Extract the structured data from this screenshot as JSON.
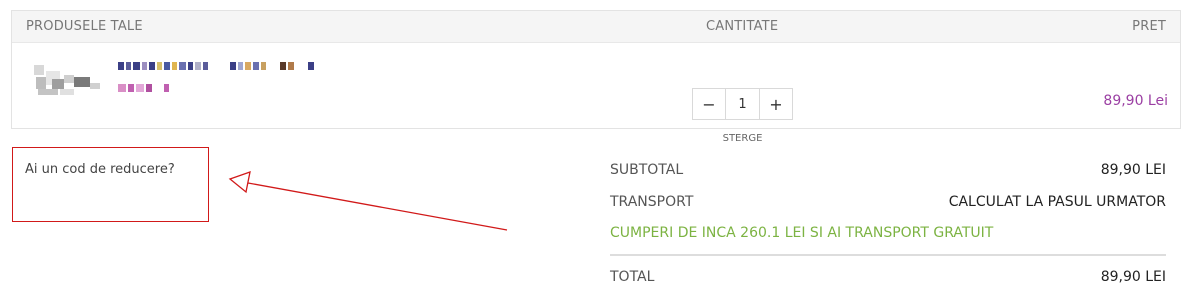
{
  "cart": {
    "headers": {
      "product": "PRODUSELE TALE",
      "quantity": "CANTITATE",
      "price": "PRET"
    },
    "items": [
      {
        "quantity": "1",
        "remove_label": "STERGE",
        "price": "89,90 Lei",
        "price_color": "#9b3fa3",
        "minus_icon": "minus-icon",
        "plus_icon": "plus-icon"
      }
    ]
  },
  "coupon": {
    "link_text": "Ai un cod de reducere?",
    "highlight_color": "#d11919"
  },
  "totals": {
    "subtotal_label": "SUBTOTAL",
    "subtotal_value": "89,90 LEI",
    "shipping_label": "TRANSPORT",
    "shipping_value": "CALCULAT LA PASUL URMATOR",
    "free_shipping_note": "CUMPERI DE INCA 260.1 LEI SI AI TRANSPORT GRATUIT",
    "free_shipping_color": "#7cb342",
    "total_label": "TOTAL",
    "total_value": "89,90 LEI"
  }
}
